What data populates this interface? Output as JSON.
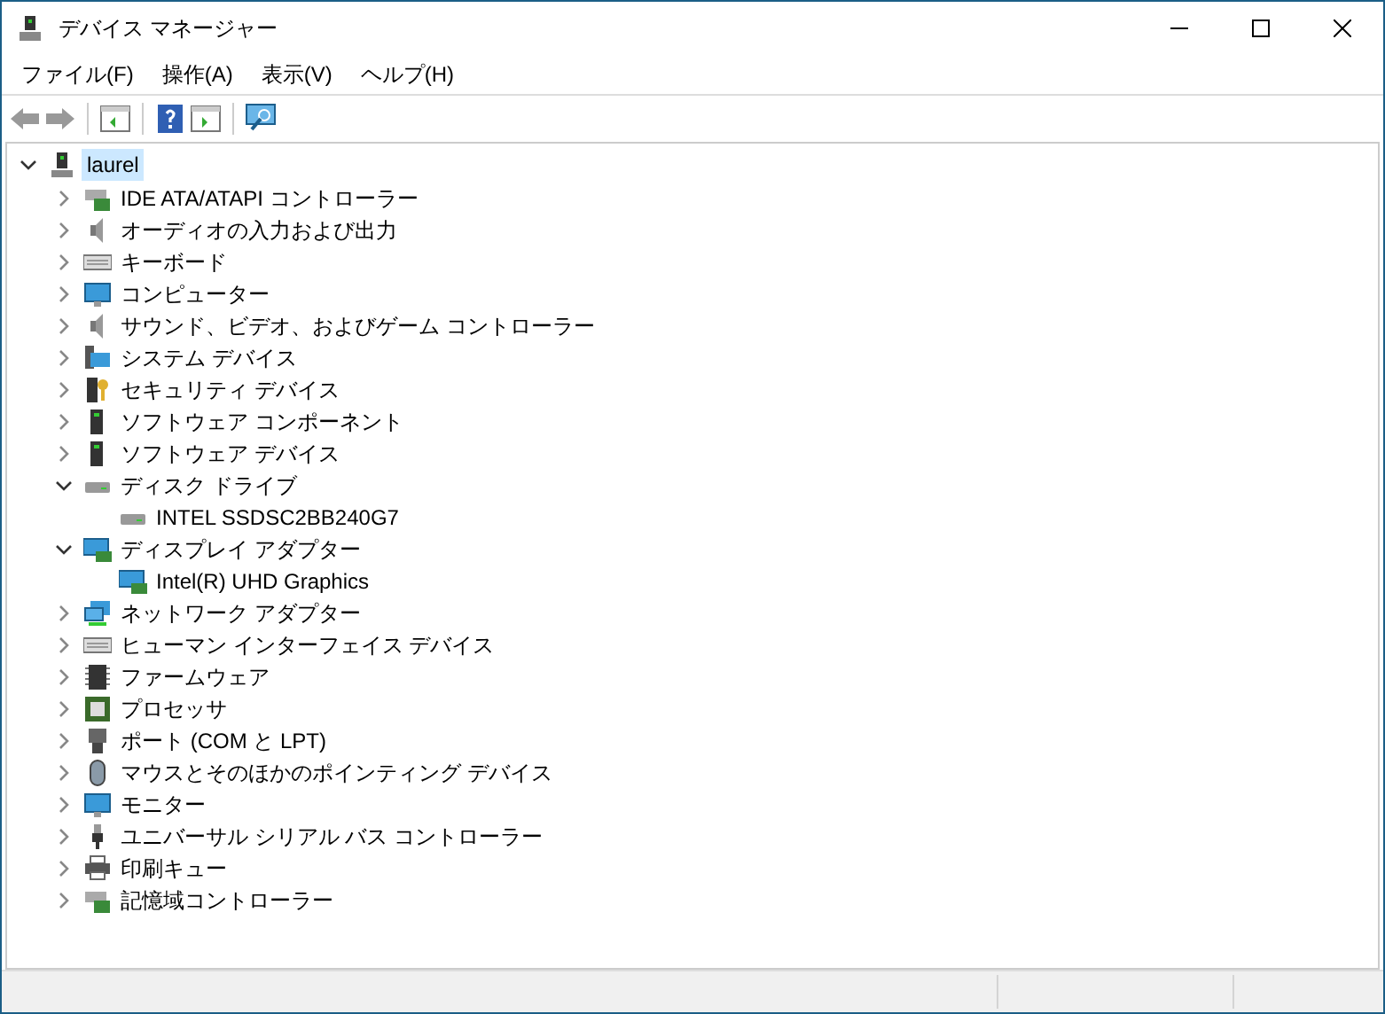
{
  "window": {
    "title": "デバイス マネージャー"
  },
  "menu": [
    "ファイル(F)",
    "操作(A)",
    "表示(V)",
    "ヘルプ(H)"
  ],
  "tree": {
    "label": "laurel",
    "expanded": true,
    "selected": true,
    "children": [
      {
        "label": "IDE ATA/ATAPI コントローラー",
        "expanded": false
      },
      {
        "label": "オーディオの入力および出力",
        "expanded": false
      },
      {
        "label": "キーボード",
        "expanded": false
      },
      {
        "label": "コンピューター",
        "expanded": false
      },
      {
        "label": "サウンド、ビデオ、およびゲーム コントローラー",
        "expanded": false
      },
      {
        "label": "システム デバイス",
        "expanded": false
      },
      {
        "label": "セキュリティ デバイス",
        "expanded": false
      },
      {
        "label": "ソフトウェア コンポーネント",
        "expanded": false
      },
      {
        "label": "ソフトウェア デバイス",
        "expanded": false
      },
      {
        "label": "ディスク ドライブ",
        "expanded": true,
        "children": [
          {
            "label": "INTEL SSDSC2BB240G7"
          }
        ]
      },
      {
        "label": "ディスプレイ アダプター",
        "expanded": true,
        "children": [
          {
            "label": "Intel(R) UHD Graphics"
          }
        ]
      },
      {
        "label": "ネットワーク アダプター",
        "expanded": false
      },
      {
        "label": "ヒューマン インターフェイス デバイス",
        "expanded": false
      },
      {
        "label": "ファームウェア",
        "expanded": false
      },
      {
        "label": "プロセッサ",
        "expanded": false
      },
      {
        "label": "ポート (COM と LPT)",
        "expanded": false
      },
      {
        "label": "マウスとそのほかのポインティング デバイス",
        "expanded": false
      },
      {
        "label": "モニター",
        "expanded": false
      },
      {
        "label": "ユニバーサル シリアル バス コントローラー",
        "expanded": false
      },
      {
        "label": "印刷キュー",
        "expanded": false
      },
      {
        "label": "記憶域コントローラー",
        "expanded": false
      }
    ]
  }
}
